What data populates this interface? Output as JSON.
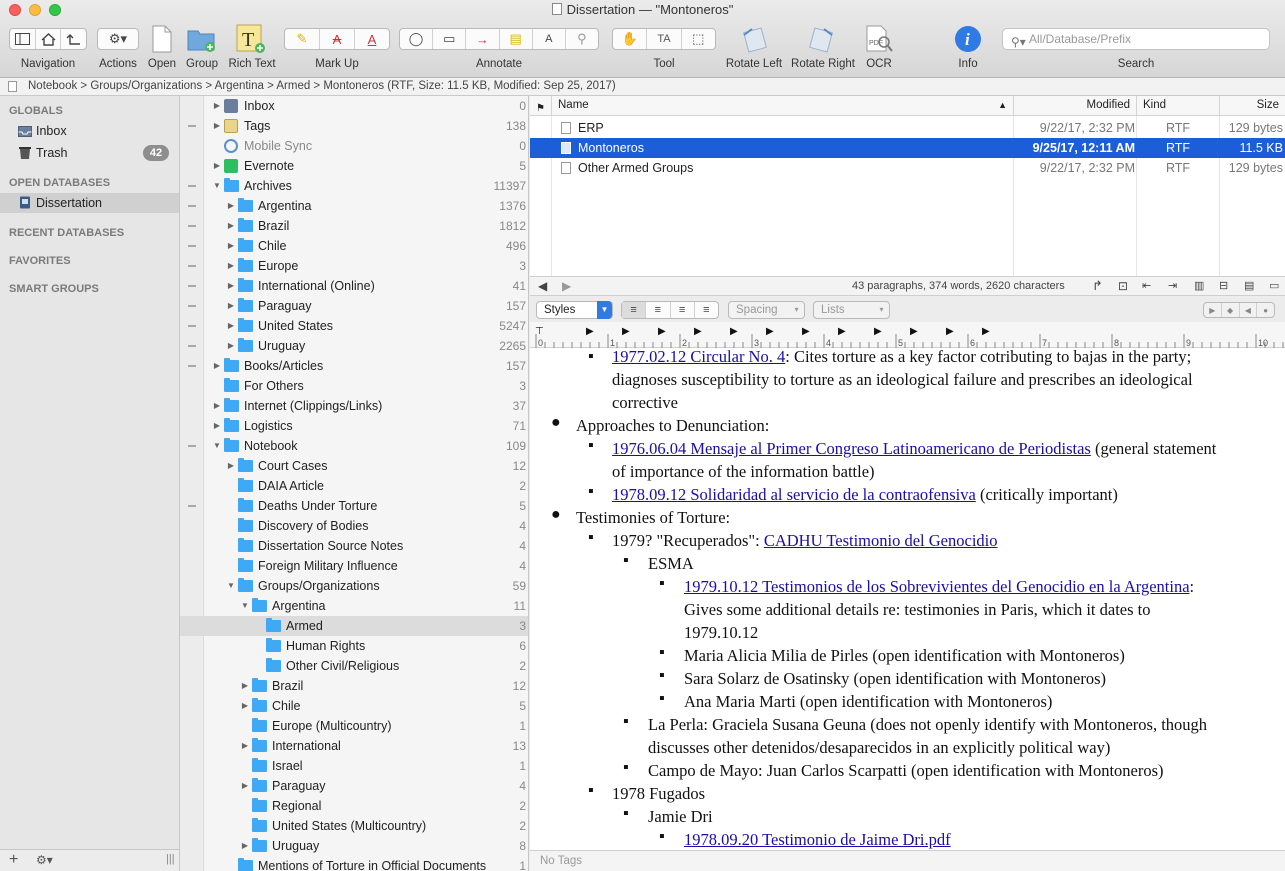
{
  "window": {
    "title": "Dissertation — \"Montoneros\""
  },
  "toolbar": {
    "navigation": "Navigation",
    "actions": "Actions",
    "open": "Open",
    "group": "Group",
    "rich_text": "Rich Text",
    "markup": "Mark Up",
    "annotate": "Annotate",
    "tool": "Tool",
    "rotate_left": "Rotate Left",
    "rotate_right": "Rotate Right",
    "ocr": "OCR",
    "info": "Info",
    "search_label": "Search",
    "search_placeholder": "All/Database/Prefix"
  },
  "pathbar": "Notebook > Groups/Organizations > Argentina > Armed > Montoneros (RTF, Size: 11.5 KB, Modified: Sep 25, 2017)",
  "sidebar": {
    "globals": "GLOBALS",
    "inbox": "Inbox",
    "trash": "Trash",
    "trash_count": "42",
    "open_databases": "OPEN DATABASES",
    "dissertation": "Dissertation",
    "recent_databases": "RECENT DATABASES",
    "favorites": "FAVORITES",
    "smart_groups": "SMART GROUPS"
  },
  "outline": [
    {
      "name": "Inbox",
      "count": "0"
    },
    {
      "name": "Tags",
      "count": "138"
    },
    {
      "name": "Mobile Sync",
      "count": "0"
    },
    {
      "name": "Evernote",
      "count": "5"
    },
    {
      "name": "Archives",
      "count": "11397"
    },
    {
      "name": "Argentina",
      "count": "1376"
    },
    {
      "name": "Brazil",
      "count": "1812"
    },
    {
      "name": "Chile",
      "count": "496"
    },
    {
      "name": "Europe",
      "count": "3"
    },
    {
      "name": "International (Online)",
      "count": "41"
    },
    {
      "name": "Paraguay",
      "count": "157"
    },
    {
      "name": "United States",
      "count": "5247"
    },
    {
      "name": "Uruguay",
      "count": "2265"
    },
    {
      "name": "Books/Articles",
      "count": "157"
    },
    {
      "name": "For Others",
      "count": "3"
    },
    {
      "name": "Internet (Clippings/Links)",
      "count": "37"
    },
    {
      "name": "Logistics",
      "count": "71"
    },
    {
      "name": "Notebook",
      "count": "109"
    },
    {
      "name": "Court Cases",
      "count": "12"
    },
    {
      "name": "DAIA Article",
      "count": "2"
    },
    {
      "name": "Deaths Under Torture",
      "count": "5"
    },
    {
      "name": "Discovery of Bodies",
      "count": "4"
    },
    {
      "name": "Dissertation Source Notes",
      "count": "4"
    },
    {
      "name": "Foreign Military Influence",
      "count": "4"
    },
    {
      "name": "Groups/Organizations",
      "count": "59"
    },
    {
      "name": "Argentina",
      "count": "11"
    },
    {
      "name": "Armed",
      "count": "3"
    },
    {
      "name": "Human Rights",
      "count": "6"
    },
    {
      "name": "Other Civil/Religious",
      "count": "2"
    },
    {
      "name": "Brazil",
      "count": "12"
    },
    {
      "name": "Chile",
      "count": "5"
    },
    {
      "name": "Europe (Multicountry)",
      "count": "1"
    },
    {
      "name": "International",
      "count": "13"
    },
    {
      "name": "Israel",
      "count": "1"
    },
    {
      "name": "Paraguay",
      "count": "4"
    },
    {
      "name": "Regional",
      "count": "2"
    },
    {
      "name": "United States (Multicountry)",
      "count": "2"
    },
    {
      "name": "Uruguay",
      "count": "8"
    },
    {
      "name": "Mentions of Torture in Official Documents",
      "count": "1"
    }
  ],
  "list": {
    "headers": {
      "name": "Name",
      "modified": "Modified",
      "kind": "Kind",
      "size": "Size"
    },
    "rows": [
      {
        "name": "ERP",
        "modified": "9/22/17, 2:32 PM",
        "kind": "RTF",
        "size": "129 bytes"
      },
      {
        "name": "Montoneros",
        "modified": "9/25/17, 12:11 AM",
        "kind": "RTF",
        "size": "11.5 KB"
      },
      {
        "name": "Other Armed Groups",
        "modified": "9/22/17, 2:32 PM",
        "kind": "RTF",
        "size": "129 bytes"
      }
    ]
  },
  "status": "43 paragraphs, 374 words, 2620 characters",
  "format": {
    "styles": "Styles",
    "spacing": "Spacing",
    "lists": "Lists"
  },
  "ruler": [
    "0",
    "1",
    "2",
    "3",
    "4",
    "5",
    "6",
    "7",
    "8",
    "9",
    "10"
  ],
  "editor": {
    "l1_link": "1977.02.12 Circular No. 4",
    "l1_text": ": Cites torture as a key factor cotributing to bajas in the party;",
    "l2": "diagnoses susceptibility to torture as an ideological failure and prescribes an ideological",
    "l3": "corrective",
    "l4": "Approaches to Denunciation:",
    "l5_link": "1976.06.04 Mensaje al Primer Congreso Latinoamericano de Periodistas",
    "l5_text": " (general statement",
    "l6": "of importance of the information battle)",
    "l7_link": "1978.09.12 Solidaridad al servicio de la contraofensiva",
    "l7_text": " (critically important)",
    "l8": "Testimonies of Torture:",
    "l9_text": "1979? \"Recuperados\": ",
    "l9_link": "CADHU Testimonio del Genocidio",
    "l10": "ESMA",
    "l11_link": "1979.10.12 Testimonios de los Sobrevivientes del Genocidio en la Argentina",
    "l11_text": ":",
    "l12": "Gives some additional details re: testimonies in Paris, which it dates to",
    "l13": "1979.10.12",
    "l14": "Maria Alicia Milia de Pirles (open identification with Montoneros)",
    "l15": "Sara Solarz de Osatinsky (open identification with Montoneros)",
    "l16": "Ana Maria Marti (open identification with Montoneros)",
    "l17": "La Perla: Graciela Susana Geuna (does not openly identify with Montoneros, though",
    "l18": "discusses other detenidos/desaparecidos in an explicitly political way)",
    "l19": "Campo de Mayo: Juan Carlos Scarpatti (open identification with Montoneros)",
    "l20": "1978 Fugados",
    "l21": "Jamie Dri",
    "l22_link": "1978.09.20 Testimonio de Jaime Dri.pdf"
  },
  "tags": "No Tags"
}
